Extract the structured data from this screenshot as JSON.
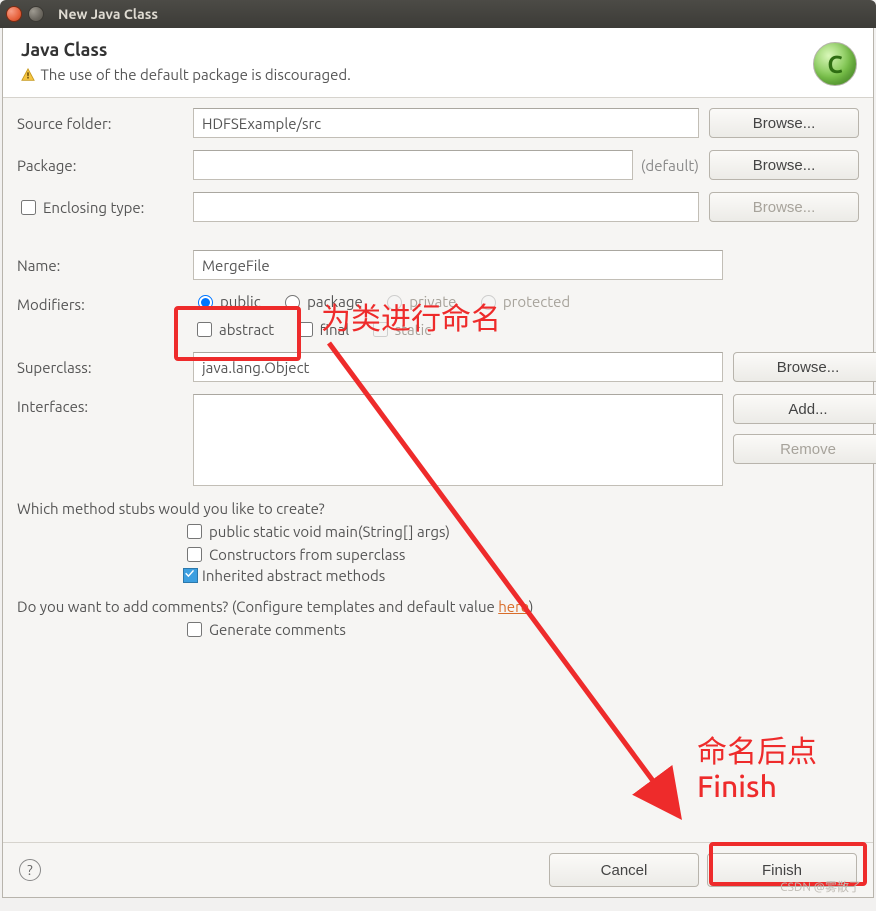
{
  "window": {
    "title": "New Java Class"
  },
  "header": {
    "title": "Java Class",
    "warning": "The use of the default package is discouraged.",
    "badge_letter": "C"
  },
  "labels": {
    "source_folder": "Source folder:",
    "package": "Package:",
    "enclosing_type": "Enclosing type:",
    "name": "Name:",
    "modifiers": "Modifiers:",
    "superclass": "Superclass:",
    "interfaces": "Interfaces:",
    "default_suffix": "(default)"
  },
  "values": {
    "source_folder": "HDFSExample/src",
    "package": "",
    "enclosing_type": "",
    "name": "MergeFile",
    "superclass": "java.lang.Object",
    "interfaces": ""
  },
  "modifiers": {
    "public": "public",
    "package": "package",
    "private": "private",
    "protected": "protected",
    "abstract": "abstract",
    "final": "final",
    "static": "static"
  },
  "buttons": {
    "browse": "Browse...",
    "add": "Add...",
    "remove": "Remove",
    "cancel": "Cancel",
    "finish": "Finish"
  },
  "questions": {
    "stubs": "Which method stubs would you like to create?",
    "main": "public static void main(String[] args)",
    "constructors": "Constructors from superclass",
    "inherited": "Inherited abstract methods",
    "comments_q": "Do you want to add comments? (Configure templates and default value ",
    "here": "here",
    "comments_q_end": ")",
    "gen_comments": "Generate comments"
  },
  "annotations": {
    "name_hint": "为类进行命名",
    "finish_hint": "命名后点\nFinish"
  },
  "watermark": "CSDN @雾散了"
}
